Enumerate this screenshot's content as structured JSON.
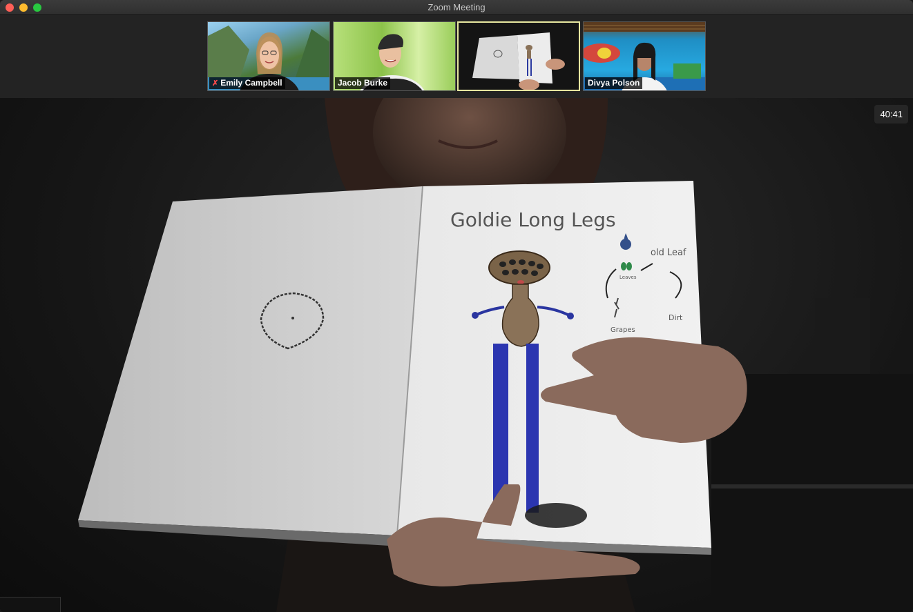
{
  "window": {
    "title": "Zoom Meeting"
  },
  "participants": [
    {
      "name": "Emily Campbell",
      "muted": true
    },
    {
      "name": "Jacob Burke",
      "muted": false
    },
    {
      "name": "",
      "muted": false
    },
    {
      "name": "Divya Polson",
      "muted": false
    }
  ],
  "main": {
    "timer": "40:41",
    "book": {
      "title": "Goldie Long Legs",
      "labels": {
        "old": "old Leaf",
        "leaves": "Leaves",
        "grapes": "Grapes",
        "dirt": "Dirt"
      }
    }
  },
  "icons": {
    "mute": "microphone-muted-icon"
  }
}
